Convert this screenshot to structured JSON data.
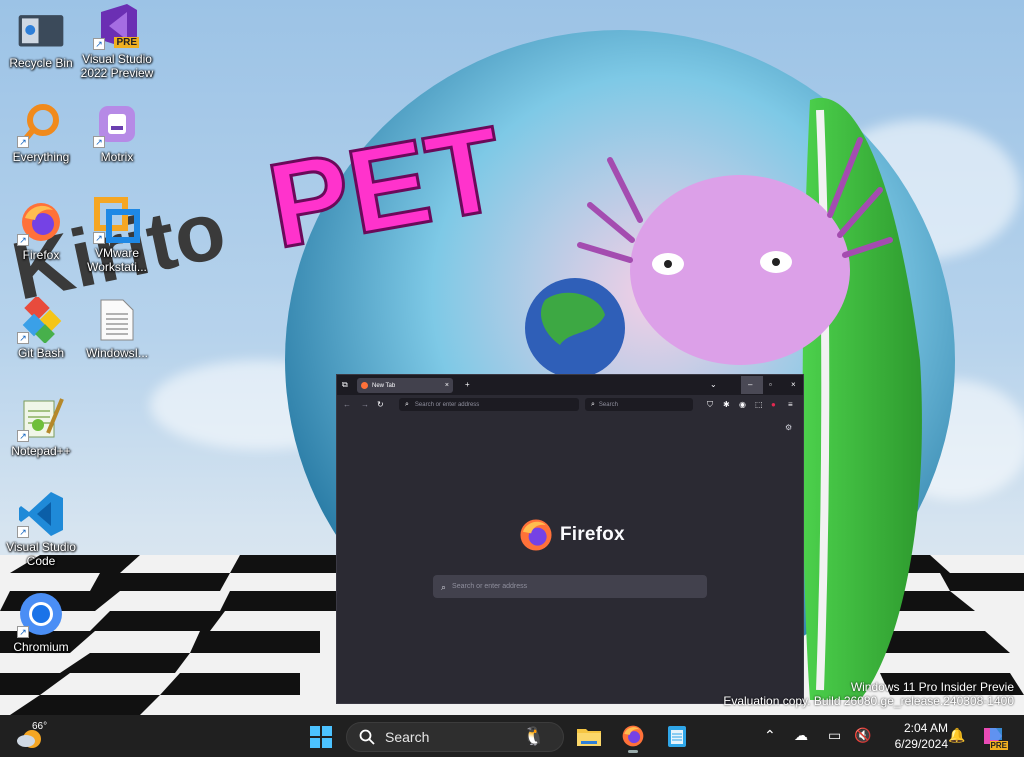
{
  "desktop": {
    "icons": [
      {
        "label": "Recycle Bin"
      },
      {
        "label": "Visual Studio 2022 Preview"
      },
      {
        "label": "Everything"
      },
      {
        "label": "Motrix"
      },
      {
        "label": "Firefox"
      },
      {
        "label": "VMware Workstati..."
      },
      {
        "label": "Git Bash"
      },
      {
        "label": "WindowsI..."
      },
      {
        "label": "Notepad++"
      },
      {
        "label": "Visual Studio Code"
      },
      {
        "label": "Chromium"
      }
    ],
    "wallpaper_text": "KiritoPET",
    "vs_badge": "PRE"
  },
  "firefox": {
    "tab_title": "New Tab",
    "url_placeholder": "Search or enter address",
    "search_placeholder": "Search",
    "brand": "Firefox",
    "content_search_placeholder": "Search or enter address"
  },
  "watermark": {
    "line1": "Windows 11 Pro Insider Previe",
    "line2": "Evaluation copy. Build 26080.ge_release.240308-1400"
  },
  "taskbar": {
    "weather_temp": "66°",
    "search_label": "Search",
    "time": "2:04 AM",
    "date": "6/29/2024",
    "copilot_badge": "PRE"
  },
  "colors": {
    "taskbar": "#202020",
    "firefox_bg": "#2b2a33",
    "firefox_accent": "#ff7139"
  }
}
